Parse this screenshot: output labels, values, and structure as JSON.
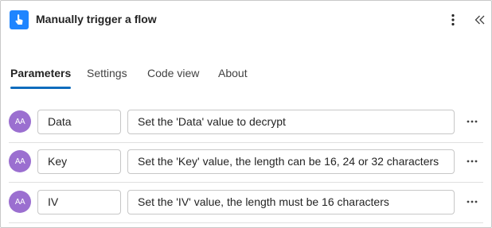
{
  "header": {
    "title": "Manually trigger a flow",
    "icon": "hand-touch-icon",
    "accent_color": "#1f85ff"
  },
  "tabs": [
    {
      "label": "Parameters",
      "active": true
    },
    {
      "label": "Settings",
      "active": false
    },
    {
      "label": "Code view",
      "active": false
    },
    {
      "label": "About",
      "active": false
    }
  ],
  "parameters": [
    {
      "avatar": "AA",
      "name": "Data",
      "description": "Set the 'Data' value to decrypt"
    },
    {
      "avatar": "AA",
      "name": "Key",
      "description": "Set the 'Key' value, the length can be 16, 24 or 32 characters"
    },
    {
      "avatar": "AA",
      "name": "IV",
      "description": "Set the 'IV' value, the length must be 16 characters"
    }
  ],
  "colors": {
    "tab_underline": "#0f6cbd",
    "avatar_bg": "#9b6fd0"
  }
}
